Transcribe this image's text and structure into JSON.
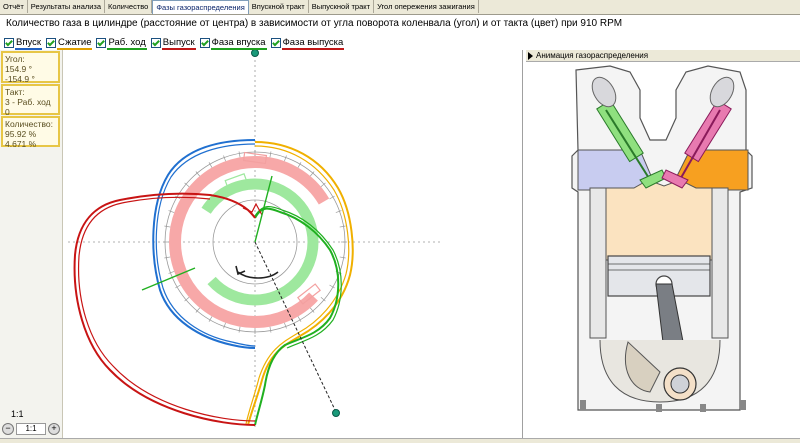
{
  "tabs": [
    {
      "label": "Отчёт"
    },
    {
      "label": "Результаты анализа"
    },
    {
      "label": "Количество"
    },
    {
      "label": "Фазы газораспределения",
      "active": true
    },
    {
      "label": "Впускной тракт"
    },
    {
      "label": "Выпускной тракт"
    },
    {
      "label": "Угол опережения зажигания"
    }
  ],
  "title": "Количество газа в цилиндре (расстояние от центра) в зависимости от угла поворота коленвала (угол) и от такта (цвет) при 910 RPM",
  "checkboxes": [
    {
      "label": "Впуск",
      "color": "#2060c0",
      "checked": true
    },
    {
      "label": "Сжатие",
      "color": "#e0a000",
      "checked": true
    },
    {
      "label": "Раб. ход",
      "color": "#20a020",
      "checked": true
    },
    {
      "label": "Выпуск",
      "color": "#c01818",
      "checked": true
    },
    {
      "label": "Фаза впуска",
      "color": "#20a020",
      "checked": true
    },
    {
      "label": "Фаза выпуска",
      "color": "#c01818",
      "checked": true
    }
  ],
  "info": {
    "angle_label": "Угол:",
    "angle_value1": "154.9 °",
    "angle_value2": "-154.9 °",
    "stroke_label": "Такт:",
    "stroke_value1": "3 - Раб. ход",
    "stroke_value2": "0",
    "amount_label": "Количество:",
    "amount_value1": "95.92 %",
    "amount_value2": "4.671 %"
  },
  "zoom": {
    "label": "1:1",
    "value": "1:1",
    "minus": "−",
    "plus": "+"
  },
  "animation": {
    "header": "Анимация газораспределения"
  },
  "colors": {
    "intake": "#2070d0",
    "compression": "#f0b000",
    "power": "#20b020",
    "exhaust": "#c81414",
    "intake_phase_ring": "#9ee89e",
    "exhaust_phase_ring": "#f7a8a8",
    "intake_valve": "#8fe07f",
    "exhaust_valve": "#e87ab0",
    "intake_gas": "#c8ccf0",
    "exhaust_gas": "#f7a020",
    "chamber": "#fbe3c0",
    "piston": "#e4e6ea"
  }
}
